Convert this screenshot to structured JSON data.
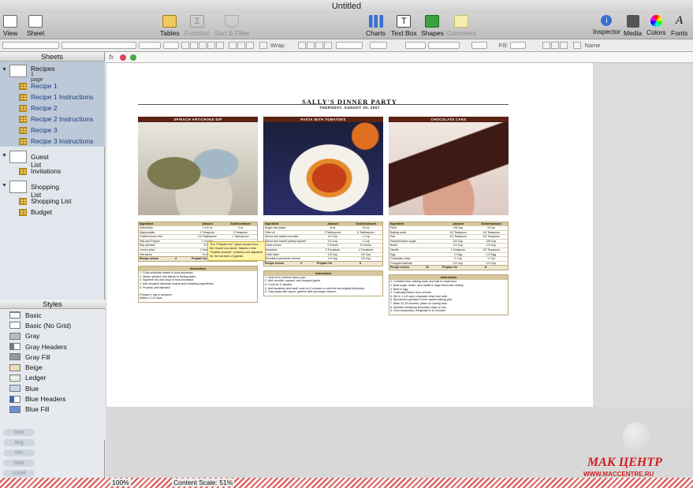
{
  "window": {
    "title": "Untitled"
  },
  "toolbar": {
    "view": "View",
    "sheet": "Sheet",
    "tables": "Tables",
    "function": "Function",
    "sort_filter": "Sort & Filter",
    "charts": "Charts",
    "text_box": "Text Box",
    "shapes": "Shapes",
    "comment": "Comment",
    "inspector": "Inspector",
    "media": "Media",
    "colors": "Colors",
    "fonts": "Fonts"
  },
  "formatbar": {
    "wrap": "Wrap",
    "fill": "Fill:",
    "name": "Name"
  },
  "formula": {
    "fx": "fx"
  },
  "sidebar": {
    "sheets_header": "Sheets",
    "styles_header": "Styles",
    "sheets": [
      {
        "name": "Recipes",
        "subtitle": "1 page",
        "tables": [
          "Recipe 1",
          "Recipe 1 Instructions",
          "Recipe 2",
          "Recipe 2 Instructions",
          "Recipe 3",
          "Recipe 3 Instructions"
        ]
      },
      {
        "name": "Guest List",
        "tables": [
          "Invitations"
        ]
      },
      {
        "name": "Shopping List",
        "tables": [
          "Shopping List",
          "Budget"
        ]
      }
    ],
    "styles": [
      "Basic",
      "Basic (No Grid)",
      "Gray",
      "Gray Headers",
      "Gray Fill",
      "Beige",
      "Ledger",
      "Blue",
      "Blue Headers",
      "Blue Fill"
    ],
    "functions": [
      "sum",
      "avg",
      "min",
      "max",
      "count"
    ]
  },
  "document": {
    "title": "SALLY'S DINNER PARTY",
    "date": "THURSDAY, AUGUST 30, 2007",
    "recipes": [
      {
        "header": "SPINACH ARTICHOKE DIP",
        "columns": [
          "Ingredient",
          "Amount",
          "Scaled amount"
        ],
        "rows": [
          [
            "Artichokes",
            "1 1/2 oz",
            "3 oz"
          ],
          [
            "Mayonnaise",
            "1 Teaspoon",
            "2 Teaspoon"
          ],
          [
            "Grated lemon rind",
            "1/2 Tablespoon",
            "1 Tablespoon"
          ],
          [
            "Salt and Pepper",
            "1 of each",
            ""
          ],
          [
            "Bay spinach",
            "10 oz",
            ""
          ],
          [
            "Lemon juice",
            "1 Teaspoon",
            ""
          ],
          [
            "Hot sauce",
            "to taste",
            ""
          ]
        ],
        "footer": [
          "Recipe serves",
          "4",
          "Prepare for",
          "8"
        ],
        "instructions_title": "Instructions",
        "instructions": [
          "1. Chop artichoke hearts in food processor.",
          "2. Steam spinach and blanch in boiling water.",
          "3. Squeeze dry and chop in food processor.",
          "4. Add chopped artichoke hearts and remaining ingredients.",
          "5. Process until blended.",
          "",
          "Prepare 1 day in advance",
          "Makes 2 1/2 cups"
        ]
      },
      {
        "header": "PASTA WITH TOMATOES",
        "columns": [
          "Ingredient",
          "Amount",
          "Scaled amount"
        ],
        "rows": [
          [
            "Angel hair pasta",
            "8 oz",
            "16 oz"
          ],
          [
            "Olive oil",
            "3 Tablespoon",
            "6 Tablespoon"
          ],
          [
            "Sliced and halved zucchini",
            "1/2 Cup",
            "1 Cup"
          ],
          [
            "Sliced and halved yellow squash",
            "1/2 Cup",
            "1 Cup"
          ],
          [
            "Garlic cloves",
            "3 Cloves",
            "6 Cloves"
          ],
          [
            "Tomatoes",
            "2 Tomatoes",
            "4 Tomatoes"
          ],
          [
            "Fresh basil",
            "1/3 Cup",
            "2/3 Cup"
          ],
          [
            "Shredded parmesan cheese",
            "1/3 Cup",
            "2/3 Cup"
          ]
        ],
        "footer": [
          "Recipe serves",
          "4",
          "Prepare for",
          "8"
        ],
        "instructions_title": "Instructions",
        "instructions": [
          "1. Heat oil in medium sauce pan.",
          "2. Add zucchini, squash, and chopped garlic.",
          "3. Cook for 3 minutes.",
          "4. Add tomatoes and basil; cook for 5 minutes or until hot and slightly thickened.",
          "5. Toss pasta with sauce; garnish with parmesan cheese."
        ]
      },
      {
        "header": "CHOCOLATE CAKE",
        "columns": [
          "Ingredient",
          "Amount",
          "Scaled amount"
        ],
        "rows": [
          [
            "Flour",
            "1/8 Cup",
            "9 Cup"
          ],
          [
            "Baking soda",
            "1/2 Teaspoon",
            "1/4 Teaspoon"
          ],
          [
            "Salt",
            "1/2 Teaspoon",
            "1/4 Teaspoon"
          ],
          [
            "Packed brown sugar",
            "3/4 Cup",
            "3/8 Cup"
          ],
          [
            "Butter",
            "1/2 Cup",
            "1/4 Cup"
          ],
          [
            "Vanilla",
            "1 Teaspoon",
            "1/2 Teaspoon"
          ],
          [
            "Egg",
            "1 Egg",
            "1/2 Egg"
          ],
          [
            "Chocolate chips",
            "2 Cup",
            "1 Cup"
          ],
          [
            "Chopped walnuts",
            "1/2 Cup",
            "1/4 Cup"
          ]
        ],
        "footer": [
          "Recipe serves",
          "16",
          "Prepare for",
          "8"
        ],
        "instructions_title": "Instructions",
        "instructions": [
          "1. Combine flour, baking soda, and salt in small bowl.",
          "2. Beat sugar, butter, and vanilla in large bowl until creamy.",
          "3. Beat in egg.",
          "4. Gradually beat in flour mixture.",
          "5. Stir in 1-1/4 cups chocolate chips and nuts.",
          "6. Spread into greased 9-inch square baking pan.",
          "7. Bake 20-25 minutes; place on cooling rack.",
          "8. Sprinkle remaining chocolate chips on top.",
          "9. Cool completely; refrigerate 5-10 minutes."
        ]
      }
    ],
    "tooltip": "The \"Prepare for\" value comes from the Guest List sheet. Values in the \"Scaled amount\" columns are adjusted for the number of guests."
  },
  "status": {
    "zoom": "100%",
    "content_scale": "Content Scale: 51%"
  },
  "watermark": {
    "brand": "МАК ЦЕНТР",
    "url": "WWW.MACCENTRE.RU"
  }
}
